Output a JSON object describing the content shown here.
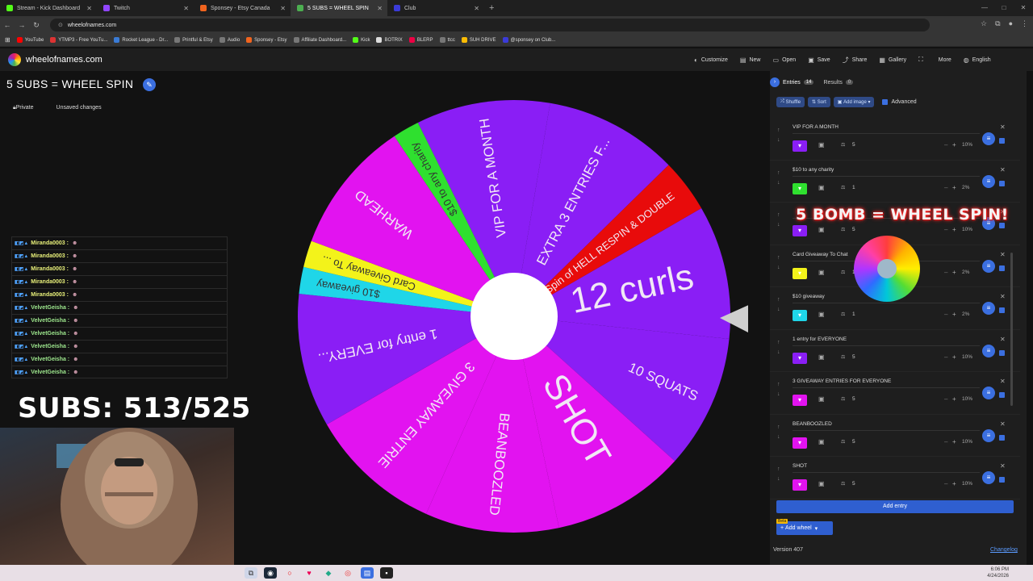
{
  "browser": {
    "tabs": [
      {
        "title": "Stream - Kick Dashboard",
        "color": "#53fc18"
      },
      {
        "title": "Twitch",
        "color": "#9146ff"
      },
      {
        "title": "Sponsey - Etsy Canada",
        "color": "#f1641e"
      },
      {
        "title": "5 SUBS = WHEEL SPIN",
        "color": "#4caf50"
      },
      {
        "title": "Club",
        "color": "#3b3bd8"
      }
    ],
    "url": "wheelofnames.com",
    "bookmarks": [
      {
        "label": "YouTube",
        "color": "#ff0000"
      },
      {
        "label": "YTMP3 - Free YouTu...",
        "color": "#d33"
      },
      {
        "label": "Rocket League - Dr...",
        "color": "#3a7bd5"
      },
      {
        "label": "Printful & Etsy",
        "color": "#777"
      },
      {
        "label": "Audio",
        "color": "#777"
      },
      {
        "label": "Sponsey - Etsy",
        "color": "#f1641e"
      },
      {
        "label": "Affiliate Dashboard...",
        "color": "#777"
      },
      {
        "label": "Kick",
        "color": "#53fc18"
      },
      {
        "label": "BOTRIX",
        "color": "#ddd"
      },
      {
        "label": "BLERP",
        "color": "#e04"
      },
      {
        "label": "ttcc",
        "color": "#777"
      },
      {
        "label": "SUH DRIVE",
        "color": "#fbbc04"
      },
      {
        "label": "@sponsey on Club...",
        "color": "#3b3bd8"
      }
    ]
  },
  "app": {
    "site": "wheelofnames.com",
    "menu": [
      {
        "label": "Customize",
        "icon": "palette-icon"
      },
      {
        "label": "New",
        "icon": "new-file-icon"
      },
      {
        "label": "Open",
        "icon": "folder-icon"
      },
      {
        "label": "Save",
        "icon": "save-icon"
      },
      {
        "label": "Share",
        "icon": "share-icon"
      },
      {
        "label": "Gallery",
        "icon": "gallery-icon"
      },
      {
        "label": "",
        "icon": "fullscreen-icon"
      },
      {
        "label": "More",
        "icon": "chevron-down-icon"
      },
      {
        "label": "English",
        "icon": "globe-icon"
      }
    ]
  },
  "page": {
    "title": "5 SUBS = WHEEL SPIN",
    "private": "Private",
    "unsaved": "Unsaved changes"
  },
  "chat": [
    {
      "name": "Miranda0003 :",
      "v": false
    },
    {
      "name": "Miranda0003 :",
      "v": false
    },
    {
      "name": "Miranda0003 :",
      "v": false
    },
    {
      "name": "Miranda0003 :",
      "v": false
    },
    {
      "name": "Miranda0003 :",
      "v": false
    },
    {
      "name": "VelvetGeisha :",
      "v": true
    },
    {
      "name": "VelvetGeisha :",
      "v": true
    },
    {
      "name": "VelvetGeisha :",
      "v": true
    },
    {
      "name": "VelvetGeisha :",
      "v": true
    },
    {
      "name": "VelvetGeisha :",
      "v": true
    },
    {
      "name": "VelvetGeisha :",
      "v": true
    }
  ],
  "overlay": {
    "subs": "SUBS: 513/525",
    "bomb": "5 BOMB = WHEEL SPIN!"
  },
  "wheel": {
    "slices": [
      {
        "label": "12 curls",
        "color": "#8a1ef5",
        "weight": 10
      },
      {
        "label": "10 SQUATS",
        "color": "#8a1ef5",
        "weight": 10
      },
      {
        "label": "SHOT",
        "color": "#e213f0",
        "weight": 10
      },
      {
        "label": "BEANBOOZLED",
        "color": "#e213f0",
        "weight": 10
      },
      {
        "label": "3 GIVEAWAY ENTRIE",
        "color": "#e213f0",
        "weight": 10
      },
      {
        "label": "1 entry for EVERY...",
        "color": "#8a1ef5",
        "weight": 10
      },
      {
        "label": "$10 giveaway",
        "color": "#1fd6e8",
        "weight": 2
      },
      {
        "label": "Card Giveaway To ...",
        "color": "#f3f31a",
        "weight": 2
      },
      {
        "label": "WARHEAD",
        "color": "#e213f0",
        "weight": 10
      },
      {
        "label": "$10 to any charity",
        "color": "#2fe02f",
        "weight": 2
      },
      {
        "label": "VIP FOR A MONTH",
        "color": "#8a1ef5",
        "weight": 10
      },
      {
        "label": "EXTRA 3 ENTRIES F...",
        "color": "#8a1ef5",
        "weight": 10
      },
      {
        "label": "Wheel Spin of HELL RESPIN & DOUBLE",
        "color": "#e80b0b",
        "weight": 4
      }
    ]
  },
  "entries_panel": {
    "tab_entries": "Entries",
    "entries_count": "14",
    "tab_results": "Results",
    "results_count": "0",
    "shuffle": "Shuffle",
    "sort": "Sort",
    "add_image": "Add image",
    "advanced": "Advanced",
    "items": [
      {
        "name": "VIP FOR A MONTH",
        "color": "#8a1ef5",
        "weight": "5",
        "pct": "10%"
      },
      {
        "name": "$10 to any charity",
        "color": "#2fe02f",
        "weight": "1",
        "pct": "2%"
      },
      {
        "name": "",
        "color": "#8a1ef5",
        "weight": "5",
        "pct": "10%"
      },
      {
        "name": "Card Giveaway To Chat",
        "color": "#f3f31a",
        "weight": "1",
        "pct": "2%"
      },
      {
        "name": "$10 giveaway",
        "color": "#1fd6e8",
        "weight": "1",
        "pct": "2%"
      },
      {
        "name": "1 entry for EVERYONE",
        "color": "#8a1ef5",
        "weight": "5",
        "pct": "10%"
      },
      {
        "name": "3 GIVEAWAY ENTRIES FOR EVERYONE",
        "color": "#e213f0",
        "weight": "5",
        "pct": "10%"
      },
      {
        "name": "BEANBOOZLED",
        "color": "#e213f0",
        "weight": "5",
        "pct": "10%"
      },
      {
        "name": "SHOT",
        "color": "#e213f0",
        "weight": "5",
        "pct": "10%"
      }
    ],
    "add_entry": "Add entry",
    "beta": "Beta",
    "add_wheel": "Add wheel",
    "version": "Version 407",
    "changelog": "Changelog"
  },
  "taskbar": {
    "time": "6:06 PM",
    "date": "4/24/2026"
  }
}
